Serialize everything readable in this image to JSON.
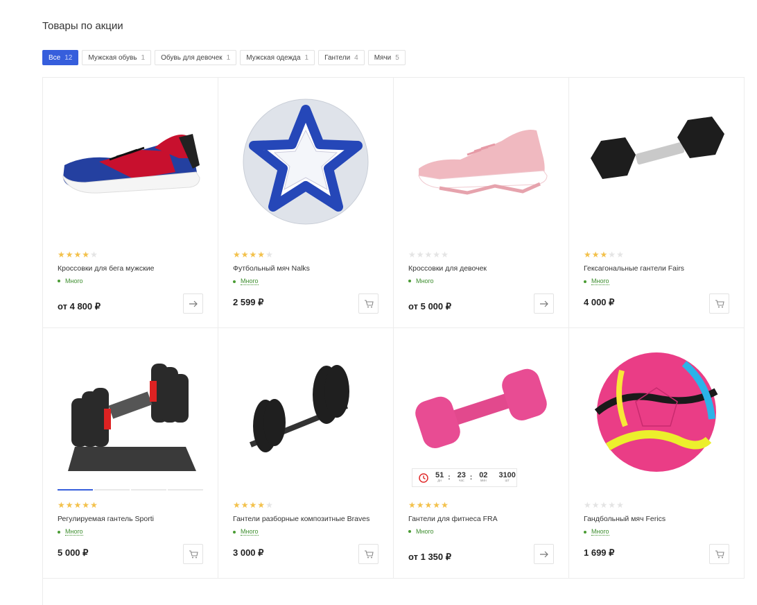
{
  "section_title": "Товары по акции",
  "filters": [
    {
      "label": "Все",
      "count": "12",
      "active": true
    },
    {
      "label": "Мужская обувь",
      "count": "1"
    },
    {
      "label": "Обувь для девочек",
      "count": "1"
    },
    {
      "label": "Мужская одежда",
      "count": "1"
    },
    {
      "label": "Гантели",
      "count": "4"
    },
    {
      "label": "Мячи",
      "count": "5"
    }
  ],
  "products": [
    {
      "name": "Кроссовки для бега мужские",
      "rating": 4,
      "stock": "Много",
      "price": "от 4 800 ₽",
      "button": "arrow-right-icon",
      "image": "sneaker-blue-red"
    },
    {
      "name": "Футбольный мяч Nalks",
      "rating": 4,
      "stock": "Много",
      "price": "2 599 ₽",
      "button": "cart-icon",
      "image": "ball-blue-star"
    },
    {
      "name": "Кроссовки для девочек",
      "rating": 0,
      "stock": "Много",
      "price": "от 5 000 ₽",
      "button": "arrow-right-icon",
      "image": "sneaker-pink"
    },
    {
      "name": "Гексагональные гантели Fairs",
      "rating": 3,
      "stock": "Много",
      "price": "4 000 ₽",
      "button": "cart-icon",
      "image": "hex-dumbbell"
    },
    {
      "name": "Регулируемая гантель Sporti",
      "rating": 5,
      "stock": "Много",
      "price": "5 000 ₽",
      "button": "cart-icon",
      "image": "adjustable-dumbbell"
    },
    {
      "name": "Гантели разборные композитные Braves",
      "rating": 4,
      "stock": "Много",
      "price": "3 000 ₽",
      "button": "cart-icon",
      "image": "plate-dumbbell"
    },
    {
      "name": "Гантели для фитнеса FRA",
      "rating": 5,
      "stock": "Много",
      "price": "от 1 350 ₽",
      "button": "arrow-right-icon",
      "image": "pink-dumbbell"
    },
    {
      "name": "Гандбольный мяч Ferics",
      "rating": 0,
      "stock": "Много",
      "price": "1 699 ₽",
      "button": "cart-icon",
      "image": "ball-pink"
    }
  ],
  "timer": {
    "days": "51",
    "days_label": "дн",
    "hours": "23",
    "hours_label": "час",
    "minutes": "02",
    "minutes_label": "мин",
    "qty": "3100",
    "qty_label": "шт"
  },
  "colors": {
    "accent": "#365edc",
    "star": "#f3c14b",
    "stock": "#3e8e2f"
  }
}
